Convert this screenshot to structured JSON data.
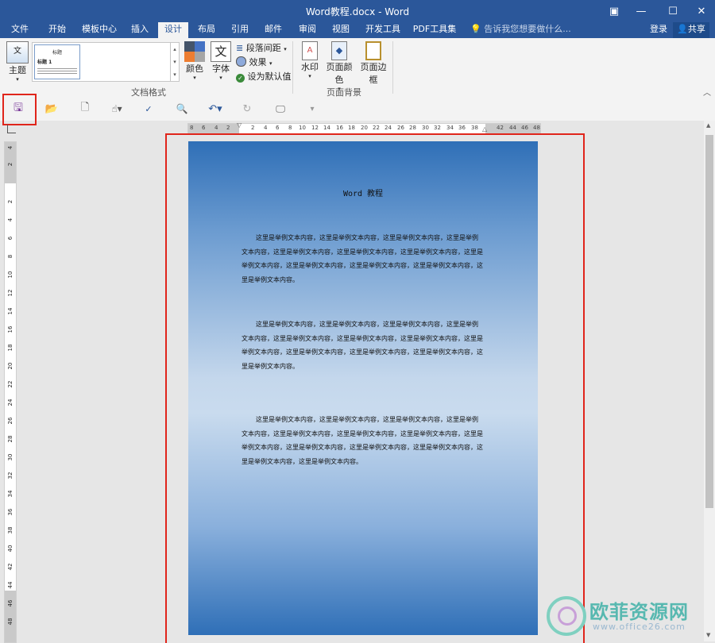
{
  "window": {
    "title": "Word教程.docx - Word",
    "buttons": {
      "ribbon_display": "▣",
      "minimize": "—",
      "maximize": "☐",
      "close": "✕"
    }
  },
  "menu": {
    "tabs": [
      "文件",
      "开始",
      "模板中心",
      "插入",
      "设计",
      "布局",
      "引用",
      "邮件",
      "审阅",
      "视图",
      "开发工具",
      "PDF工具集"
    ],
    "active_tab": "设计",
    "tell_me_placeholder": "告诉我您想要做什么...",
    "login": "登录",
    "share": "共享"
  },
  "ribbon": {
    "theme_label": "主题",
    "style_preview_title": "标题",
    "style_preview_heading": "标题 1",
    "colors_label": "颜色",
    "fonts_label": "字体",
    "paragraph_spacing": "段落间距",
    "effects": "效果",
    "set_default": "设为默认值",
    "group_document_format": "文档格式",
    "watermark": "水印",
    "page_color": "页面颜色",
    "page_borders": "页面边框",
    "group_page_background": "页面背景",
    "collapse_icon": "︿"
  },
  "ruler": {
    "left_marks": [
      "8",
      "6",
      "4",
      "2"
    ],
    "right_marks": [
      "2",
      "4",
      "6",
      "8",
      "10",
      "12",
      "14",
      "16",
      "18",
      "20",
      "22",
      "24",
      "26",
      "28",
      "30",
      "32",
      "34",
      "36",
      "38",
      "42",
      "44",
      "46",
      "48"
    ],
    "vertical_marks": [
      "4",
      "2",
      "2",
      "4",
      "6",
      "8",
      "10",
      "12",
      "14",
      "16",
      "18",
      "20",
      "22",
      "24",
      "26",
      "28",
      "30",
      "32",
      "34",
      "36",
      "38",
      "40",
      "42",
      "44",
      "46",
      "48"
    ]
  },
  "document": {
    "title": "Word 教程",
    "paragraphs": [
      "这里是举例文本内容，这里是举例文本内容，这里是举例文本内容，这里是举例文本内容，这里是举例文本内容，这里是举例文本内容，这里是举例文本内容，这里是举例文本内容，这里是举例文本内容，这里是举例文本内容，这里是举例文本内容，这里是举例文本内容。",
      "这里是举例文本内容，这里是举例文本内容，这里是举例文本内容，这里是举例文本内容，这里是举例文本内容，这里是举例文本内容，这里是举例文本内容，这里是举例文本内容，这里是举例文本内容，这里是举例文本内容，这里是举例文本内容，这里是举例文本内容。",
      "这里是举例文本内容，这里是举例文本内容，这里是举例文本内容，这里是举例文本内容，这里是举例文本内容，这里是举例文本内容，这里是举例文本内容，这里是举例文本内容，这里是举例文本内容，这里是举例文本内容，这里是举例文本内容，这里是举例文本内容，这里是举例文本内容。"
    ]
  },
  "watermark": {
    "brand": "欧菲资源网",
    "url": "www.office26.com"
  },
  "colors": {
    "accent": "#2b579a",
    "highlight": "#e0251b",
    "page_top": "#2f6fb7",
    "page_mid": "#c9dbee"
  }
}
